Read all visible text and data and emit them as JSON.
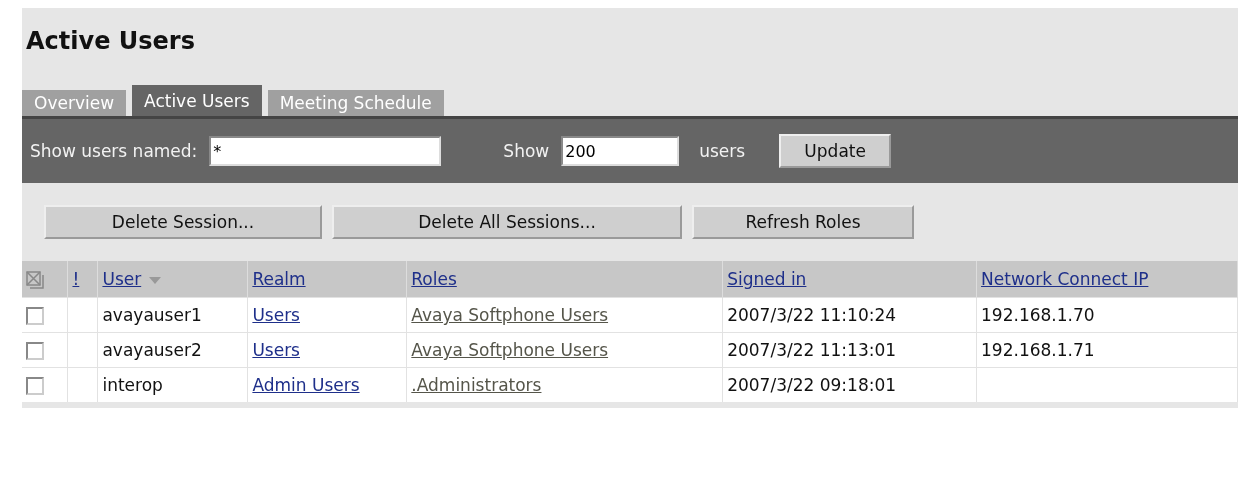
{
  "title": "Active Users",
  "tabs": [
    {
      "label": "Overview",
      "selected": false
    },
    {
      "label": "Active Users",
      "selected": true
    },
    {
      "label": "Meeting Schedule",
      "selected": false
    }
  ],
  "filter": {
    "name_label": "Show users named:",
    "name_value": "*",
    "show_label": "Show",
    "count_value": "200",
    "users_label": "users",
    "button": "Update"
  },
  "actions": [
    "Delete Session...",
    "Delete All Sessions...",
    "Refresh Roles"
  ],
  "table": {
    "columns": [
      "!",
      "User",
      "Realm",
      "Roles",
      "Signed in",
      "Network Connect IP"
    ],
    "rows": [
      {
        "checked": false,
        "user": "avayauser1",
        "realm": "Users",
        "role": "Avaya Softphone Users",
        "signed_in": "2007/3/22 11:10:24",
        "ip": "192.168.1.70"
      },
      {
        "checked": false,
        "user": "avayauser2",
        "realm": "Users",
        "role": "Avaya Softphone Users",
        "signed_in": "2007/3/22 11:13:01",
        "ip": "192.168.1.71"
      },
      {
        "checked": false,
        "user": "interop",
        "realm": "Admin Users",
        "role": ".Administrators",
        "signed_in": "2007/3/22 09:18:01"
      }
    ]
  }
}
